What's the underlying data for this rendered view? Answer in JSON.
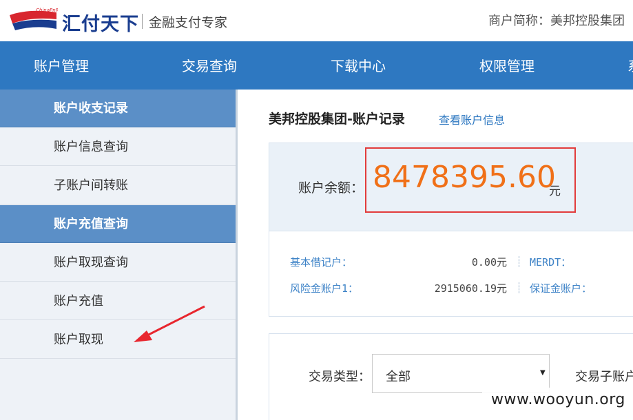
{
  "header": {
    "logo_small": "ChinaPnR",
    "logo_name": "汇付天下",
    "slogan": "金融支付专家",
    "merchant": "商户简称：美邦控股集团"
  },
  "topnav": {
    "items": [
      "账户管理",
      "交易查询",
      "下载中心",
      "权限管理",
      "系"
    ]
  },
  "sidebar": {
    "items": [
      {
        "label": "账户收支记录",
        "active": true
      },
      {
        "label": "账户信息查询",
        "active": false
      },
      {
        "label": "子账户间转账",
        "active": false
      },
      {
        "label": "账户充值查询",
        "active": true
      },
      {
        "label": "账户取现查询",
        "active": false
      },
      {
        "label": "账户充值",
        "active": false
      },
      {
        "label": "账户取现",
        "active": false
      }
    ]
  },
  "main": {
    "title": "美邦控股集团-账户记录",
    "info_link": "查看账户信息",
    "balance_label": "账户余额：",
    "balance_value": "8478395.60",
    "balance_unit": "元",
    "accounts": {
      "row1": {
        "label": "基本借记户：",
        "value": "0.00元",
        "label2": "MERDT："
      },
      "row2": {
        "label": "风险金账户1：",
        "value": "2915060.19元",
        "label2": "保证金账户："
      }
    },
    "filter": {
      "type_label": "交易类型：",
      "type_value": "全部",
      "subaccount_label": "交易子账户"
    }
  },
  "watermark": "www.wooyun.org",
  "colors": {
    "nav_bg": "#2e78c1",
    "sidebar_active": "#5b8fc7",
    "balance_value": "#f07018",
    "highlight_box": "#e23b3b",
    "annotation_arrow": "#e8262e"
  }
}
